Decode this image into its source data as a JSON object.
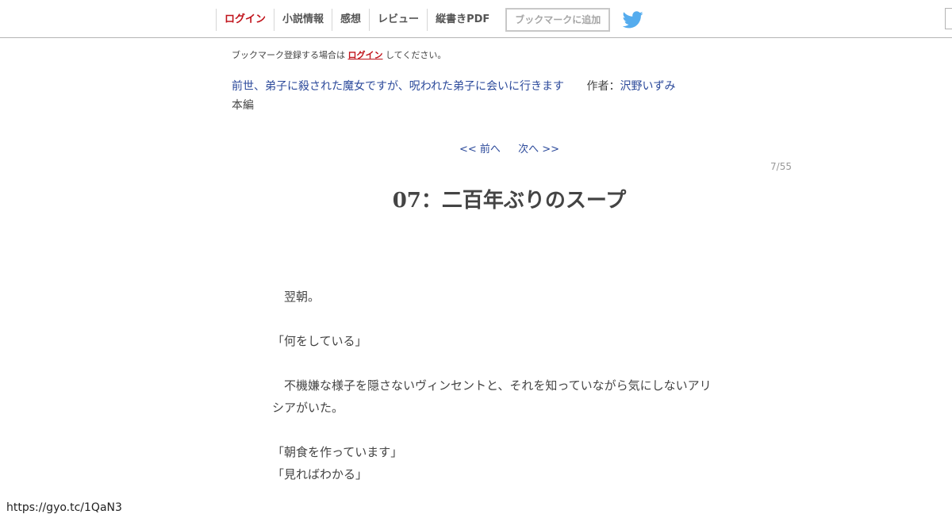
{
  "nav": {
    "login": "ログイン",
    "novel_info": "小説情報",
    "impressions": "感想",
    "review": "レビュー",
    "vertical_pdf": "縦書きPDF",
    "add_bookmark": "ブックマークに追加"
  },
  "bookmark_note": {
    "prefix": "ブックマーク登録する場合は",
    "link": "ログイン",
    "suffix": "してください。"
  },
  "novel": {
    "title": "前世、弟子に殺された魔女ですが、呪われた弟子に会いに行きます",
    "author_label": "作者：",
    "author": "沢野いずみ",
    "chapter_group": "本編"
  },
  "pager": {
    "prev": "<< 前へ",
    "next": "次へ >>",
    "count": "7/55"
  },
  "chapter": {
    "title": "07：二百年ぶりのスープ"
  },
  "body": {
    "p1": "　翌朝。",
    "p2": "「何をしている」",
    "p3a": "　不機嫌な様子を隠さないヴィンセントと、それを知っていながら気にしないアリ",
    "p3b": "シアがいた。",
    "p4": "「朝食を作っています」",
    "p5": "「見ればわかる」"
  },
  "status": {
    "url": "https://gyo.tc/1QaN3"
  },
  "colors": {
    "accent_red": "#c0131b",
    "link_blue": "#2c4a9b",
    "twitter_blue": "#55acee"
  },
  "icons": {
    "twitter": "twitter-bird-icon"
  }
}
